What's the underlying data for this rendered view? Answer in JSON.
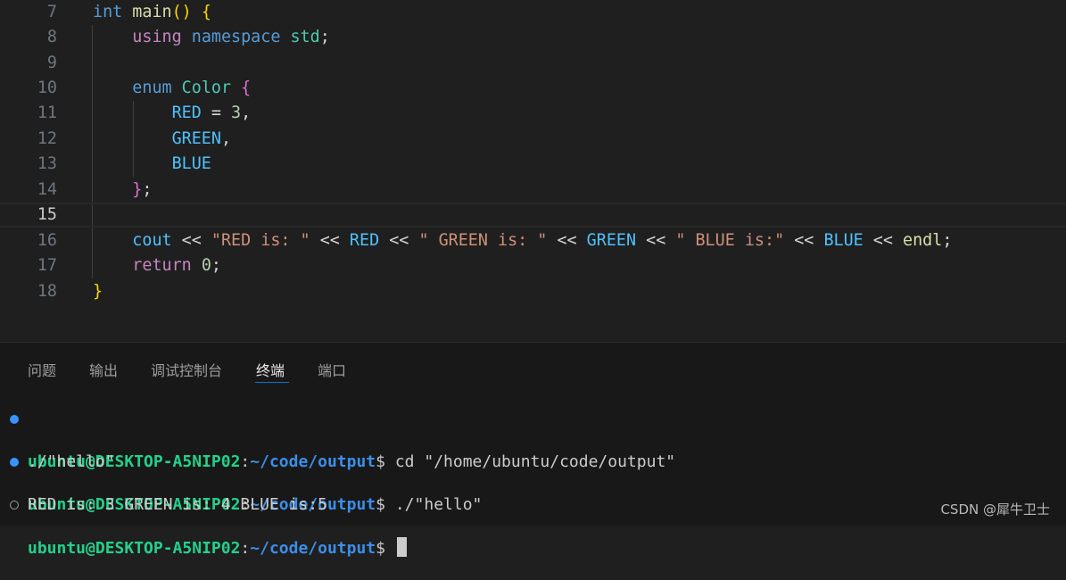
{
  "editor": {
    "line_numbers": [
      "7",
      "8",
      "9",
      "10",
      "11",
      "12",
      "13",
      "14",
      "15",
      "16",
      "17",
      "18"
    ],
    "tokens": {
      "l7_int": "int",
      "l7_main": "main",
      "l7_paren": "()",
      "l7_brace": "{",
      "l8_using": "using",
      "l8_namespace": "namespace",
      "l8_std": "std",
      "l8_semi": ";",
      "l10_enum": "enum",
      "l10_color": "Color",
      "l10_brace": "{",
      "l11_red": "RED",
      "l11_eq": " = ",
      "l11_num": "3",
      "l11_comma": ",",
      "l12_green": "GREEN",
      "l12_comma": ",",
      "l13_blue": "BLUE",
      "l14_brace": "}",
      "l14_semi": ";",
      "l16_cout": "cout",
      "l16_op1": " << ",
      "l16_s1": "\"RED is: \"",
      "l16_op2": " << ",
      "l16_red": "RED",
      "l16_op3": " << ",
      "l16_s2": "\" GREEN is: \"",
      "l16_op4": " << ",
      "l16_green": "GREEN",
      "l16_op5": " << ",
      "l16_s3": "\" BLUE is:\"",
      "l16_op6": " << ",
      "l16_blue": "BLUE",
      "l16_op7": " << ",
      "l16_endl": "endl",
      "l16_semi": ";",
      "l17_return": "return",
      "l17_num": "0",
      "l17_semi": ";",
      "l18_brace": "}"
    },
    "current_line": "15"
  },
  "panel": {
    "tabs": [
      "问题",
      "输出",
      "调试控制台",
      "终端",
      "端口"
    ],
    "active_tab": "终端"
  },
  "terminal": {
    "lines": [
      {
        "user": "ubuntu@DESKTOP-A5NIP02",
        "colon": ":",
        "path": "~/code/output",
        "prompt": "$ ",
        "cmd": "cd \"/home/ubuntu/code/output\""
      },
      {
        "output": "./\"hello\""
      },
      {
        "user": "ubuntu@DESKTOP-A5NIP02",
        "colon": ":",
        "path": "~/code/output",
        "prompt": "$ ",
        "cmd": "./\"hello\""
      },
      {
        "output": "RED is: 3 GREEN is: 4 BLUE is:5"
      },
      {
        "user": "ubuntu@DESKTOP-A5NIP02",
        "colon": ":",
        "path": "~/code/output",
        "prompt": "$ ",
        "cmd": ""
      }
    ]
  },
  "watermark": "CSDN @犀牛卫士",
  "colors": {
    "editor_bg": "#1f1f1f",
    "panel_bg": "#181818",
    "accent": "#0078d4",
    "terminal_user": "#23d18b",
    "terminal_path": "#3b8eea"
  }
}
